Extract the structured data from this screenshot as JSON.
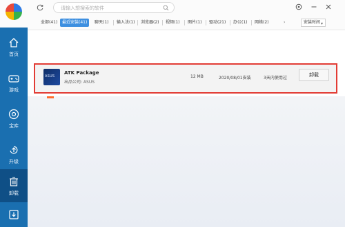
{
  "sidebar": {
    "items": [
      {
        "label": "首页",
        "icon": "home-icon"
      },
      {
        "label": "游戏",
        "icon": "gamepad-icon"
      },
      {
        "label": "宝库",
        "icon": "treasury-icon"
      },
      {
        "label": "升级",
        "icon": "upgrade-icon"
      },
      {
        "label": "卸载",
        "icon": "trash-icon",
        "active": true
      },
      {
        "label": "",
        "icon": "download-icon"
      }
    ]
  },
  "header": {
    "search_placeholder": "请输入想搜索的软件",
    "buttons": [
      "refresh-icon",
      "settings-icon",
      "minimize-icon",
      "close-icon"
    ]
  },
  "tabs": [
    {
      "label": "全部(41)"
    },
    {
      "label": "最近安装(41)",
      "active": true
    },
    {
      "label": "聊天(1)"
    },
    {
      "label": "输入法(1)"
    },
    {
      "label": "浏览器(2)"
    },
    {
      "label": "视频(1)"
    },
    {
      "label": "图片(1)"
    },
    {
      "label": "驱动(21)"
    },
    {
      "label": "办公(1)"
    },
    {
      "label": "网络(2)"
    }
  ],
  "sort": {
    "label": "安装时间"
  },
  "app": {
    "name": "ATK Package",
    "publisher": "出品公司: ASUS",
    "logo_text": "ASUS",
    "size": "12 MB",
    "install_date": "2020/08/01安装",
    "last_used": "3天内使用过",
    "uninstall_label": "卸载"
  },
  "colors": {
    "sidebar": "#1a6fb0",
    "active_tab": "#3d8fe0",
    "highlight_border": "#e23b34"
  }
}
